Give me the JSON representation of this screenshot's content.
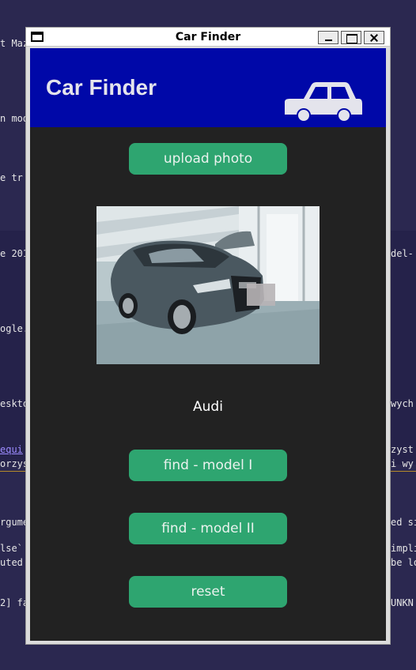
{
  "terminal": {
    "lines": [
      "t Maz",
      "n mod",
      "e tr",
      "e 201",
      "del-",
      "ogle.",
      "eskto",
      "wych",
      "equi",
      "zyst",
      "orzys",
      "i wy",
      "rgume",
      "ed si",
      "lse`",
      "impli",
      "uted",
      "be lo",
      "2] fa",
      "UNKN"
    ]
  },
  "window": {
    "title": "Car Finder"
  },
  "app": {
    "header_title": "Car Finder",
    "car_icon": "car-icon",
    "upload_label": "upload photo",
    "result_label": "Audi",
    "model1_label": "find - model I",
    "model2_label": "find - model II",
    "reset_label": "reset"
  },
  "colors": {
    "header_bg": "#0008a8",
    "app_bg": "#222222",
    "button_bg": "#2ea570"
  }
}
